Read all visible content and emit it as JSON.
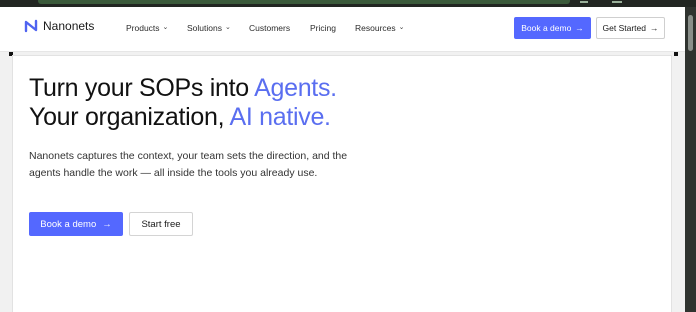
{
  "brand": {
    "name": "Nanonets",
    "logo_icon": "nanonets-logo-icon",
    "accent_color": "#5468ff"
  },
  "nav": {
    "items": [
      {
        "label": "Products",
        "has_dropdown": true
      },
      {
        "label": "Solutions",
        "has_dropdown": true
      },
      {
        "label": "Customers",
        "has_dropdown": false
      },
      {
        "label": "Pricing",
        "has_dropdown": false
      },
      {
        "label": "Resources",
        "has_dropdown": true
      }
    ],
    "dropdown_glyph": "⌄",
    "book_demo_label": "Book a demo",
    "get_started_label": "Get Started",
    "arrow_glyph": "→"
  },
  "hero": {
    "title_line1_plain": "Turn your SOPs into ",
    "title_line1_accent": "Agents.",
    "title_line2_plain": "Your organization, ",
    "title_line2_accent": "AI native.",
    "subtitle": "Nanonets captures the context, your team sets the direction, and the agents handle the work — all inside the tools you already use.",
    "cta_primary_label": "Book a demo",
    "cta_secondary_label": "Start free",
    "arrow_glyph": "→"
  }
}
